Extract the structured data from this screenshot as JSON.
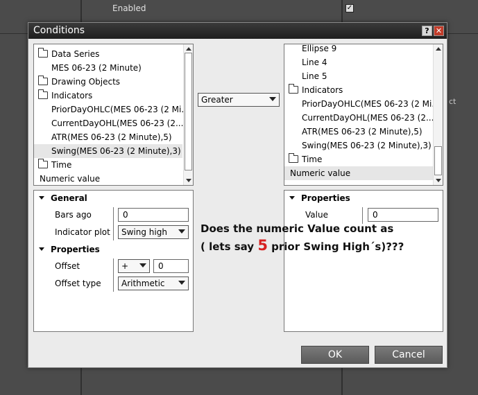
{
  "background": {
    "enabled_label": "Enabled",
    "partial_text": "ct"
  },
  "dialog": {
    "title": "Conditions",
    "help_label": "?",
    "close_label": "✕"
  },
  "left_list": {
    "items": [
      {
        "label": "Data Series",
        "folder": true
      },
      {
        "label": "MES 06-23 (2 Minute)",
        "folder": false
      },
      {
        "label": "Drawing Objects",
        "folder": true
      },
      {
        "label": "Indicators",
        "folder": true
      },
      {
        "label": "PriorDayOHLC(MES 06-23 (2 Mi...",
        "folder": false
      },
      {
        "label": "CurrentDayOHL(MES 06-23 (2...",
        "folder": false
      },
      {
        "label": "ATR(MES 06-23 (2 Minute),5)",
        "folder": false
      },
      {
        "label": "Swing(MES 06-23 (2 Minute),3)",
        "folder": false,
        "selected": true
      },
      {
        "label": "Time",
        "folder": true
      },
      {
        "label": "Numeric value",
        "folder": false
      }
    ]
  },
  "operator": {
    "value": "Greater"
  },
  "right_list": {
    "items": [
      {
        "label": "Ellipse 9",
        "folder": false
      },
      {
        "label": "Line 4",
        "folder": false
      },
      {
        "label": "Line 5",
        "folder": false
      },
      {
        "label": "Indicators",
        "folder": true
      },
      {
        "label": "PriorDayOHLC(MES 06-23 (2 Mi...",
        "folder": false
      },
      {
        "label": "CurrentDayOHL(MES 06-23 (2...",
        "folder": false
      },
      {
        "label": "ATR(MES 06-23 (2 Minute),5)",
        "folder": false
      },
      {
        "label": "Swing(MES 06-23 (2 Minute),3)",
        "folder": false
      },
      {
        "label": "Time",
        "folder": true
      },
      {
        "label": "Numeric value",
        "folder": false,
        "selected": true
      }
    ]
  },
  "left_props": {
    "general_header": "General",
    "bars_ago_label": "Bars ago",
    "bars_ago_value": "0",
    "indicator_plot_label": "Indicator plot",
    "indicator_plot_value": "Swing high",
    "properties_header": "Properties",
    "offset_label": "Offset",
    "offset_sign": "+",
    "offset_value": "0",
    "offset_type_label": "Offset type",
    "offset_type_value": "Arithmetic"
  },
  "right_props": {
    "properties_header": "Properties",
    "value_label": "Value",
    "value_value": "0"
  },
  "annotation": {
    "line1": "Does the numeric Value count as",
    "line2_before": "( lets say ",
    "line2_number": "5",
    "line2_after": " prior Swing High´s)???"
  },
  "buttons": {
    "ok": "OK",
    "cancel": "Cancel"
  }
}
